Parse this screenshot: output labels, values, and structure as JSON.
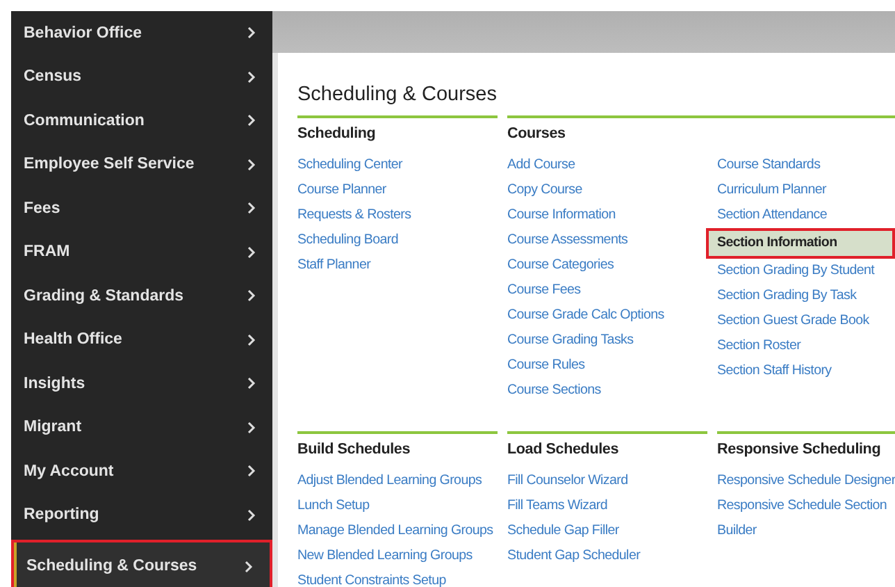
{
  "sidebar": {
    "items": [
      {
        "label": "Behavior Office",
        "selected": false
      },
      {
        "label": "Census",
        "selected": false
      },
      {
        "label": "Communication",
        "selected": false
      },
      {
        "label": "Employee Self Service",
        "selected": false
      },
      {
        "label": "Fees",
        "selected": false
      },
      {
        "label": "FRAM",
        "selected": false
      },
      {
        "label": "Grading & Standards",
        "selected": false
      },
      {
        "label": "Health Office",
        "selected": false
      },
      {
        "label": "Insights",
        "selected": false
      },
      {
        "label": "Migrant",
        "selected": false
      },
      {
        "label": "My Account",
        "selected": false
      },
      {
        "label": "Reporting",
        "selected": false
      },
      {
        "label": "Scheduling & Courses",
        "selected": true
      }
    ]
  },
  "page": {
    "title": "Scheduling & Courses",
    "sections": [
      {
        "heading": "Scheduling",
        "columns": [
          [
            {
              "label": "Scheduling Center",
              "selected": false
            },
            {
              "label": "Course Planner",
              "selected": false
            },
            {
              "label": "Requests & Rosters",
              "selected": false
            },
            {
              "label": "Scheduling Board",
              "selected": false
            },
            {
              "label": "Staff Planner",
              "selected": false
            }
          ]
        ]
      },
      {
        "heading": "Courses",
        "columns": [
          [
            {
              "label": "Add Course",
              "selected": false
            },
            {
              "label": "Copy Course",
              "selected": false
            },
            {
              "label": "Course Information",
              "selected": false
            },
            {
              "label": "Course Assessments",
              "selected": false
            },
            {
              "label": "Course Categories",
              "selected": false
            },
            {
              "label": "Course Fees",
              "selected": false
            },
            {
              "label": "Course Grade Calc Options",
              "selected": false
            },
            {
              "label": "Course Grading Tasks",
              "selected": false
            },
            {
              "label": "Course Rules",
              "selected": false
            },
            {
              "label": "Course Sections",
              "selected": false
            }
          ],
          [
            {
              "label": "Course Standards",
              "selected": false
            },
            {
              "label": "Curriculum Planner",
              "selected": false
            },
            {
              "label": "Section Attendance",
              "selected": false
            },
            {
              "label": "Section Information",
              "selected": true
            },
            {
              "label": "Section Grading By Student",
              "selected": false
            },
            {
              "label": "Section Grading By Task",
              "selected": false
            },
            {
              "label": "Section Guest Grade Book",
              "selected": false
            },
            {
              "label": "Section Roster",
              "selected": false
            },
            {
              "label": "Section Staff History",
              "selected": false
            }
          ]
        ]
      },
      {
        "heading": "Build Schedules",
        "columns": [
          [
            {
              "label": "Adjust Blended Learning Groups",
              "selected": false
            },
            {
              "label": "Lunch Setup",
              "selected": false
            },
            {
              "label": "Manage Blended Learning Groups",
              "selected": false
            },
            {
              "label": "New Blended Learning Groups",
              "selected": false
            },
            {
              "label": "Student Constraints Setup",
              "selected": false
            }
          ]
        ]
      },
      {
        "heading": "Load Schedules",
        "columns": [
          [
            {
              "label": "Fill Counselor Wizard",
              "selected": false
            },
            {
              "label": "Fill Teams Wizard",
              "selected": false
            },
            {
              "label": "Schedule Gap Filler",
              "selected": false
            },
            {
              "label": "Student Gap Scheduler",
              "selected": false
            }
          ]
        ]
      },
      {
        "heading": "Responsive Scheduling",
        "columns": [
          [
            {
              "label": "Responsive Schedule Designer",
              "selected": false
            },
            {
              "label": "Responsive Schedule Section Builder",
              "selected": false
            }
          ]
        ]
      }
    ]
  }
}
